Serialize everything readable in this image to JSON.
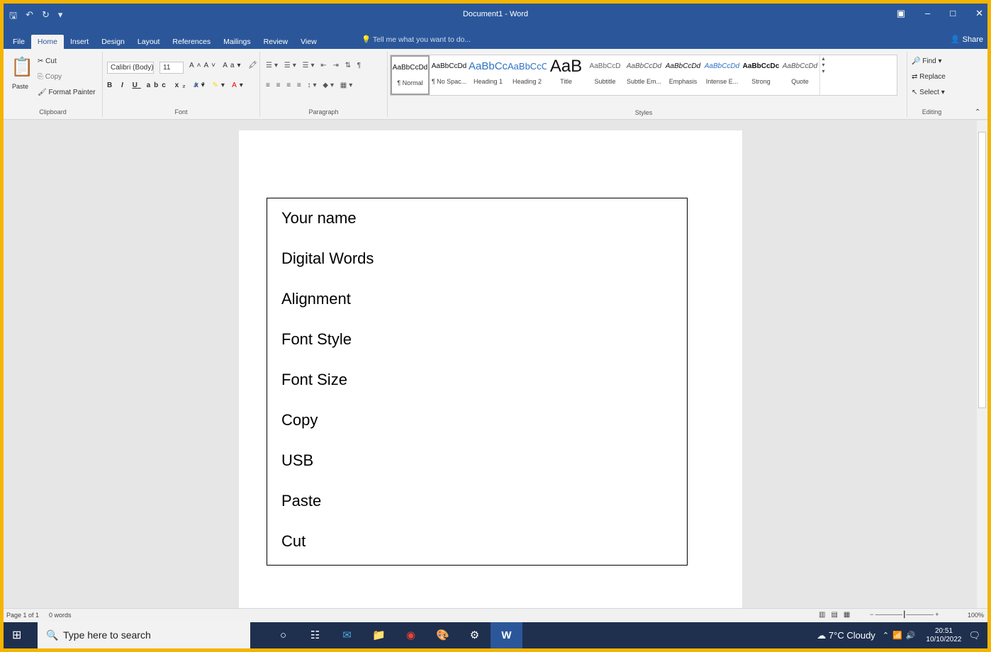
{
  "window": {
    "title": "Document1 - Word"
  },
  "menu": {
    "tabs": [
      {
        "label": "File"
      },
      {
        "label": "Home"
      },
      {
        "label": "Insert"
      },
      {
        "label": "Design"
      },
      {
        "label": "Layout"
      },
      {
        "label": "References"
      },
      {
        "label": "Mailings"
      },
      {
        "label": "Review"
      },
      {
        "label": "View"
      }
    ],
    "tell_me": "Tell me what you want to do...",
    "share": "Share"
  },
  "ribbon": {
    "clipboard": {
      "paste": "Paste",
      "cut": "Cut",
      "copy": "Copy",
      "format_painter": "Format Painter",
      "label": "Clipboard"
    },
    "font": {
      "family": "Calibri (Body)",
      "size": "11",
      "label": "Font"
    },
    "paragraph": {
      "label": "Paragraph"
    },
    "styles": {
      "items": [
        {
          "preview": "AaBbCcDd",
          "name": "¶ Normal"
        },
        {
          "preview": "AaBbCcDd",
          "name": "¶ No Spac..."
        },
        {
          "preview": "AaBbCc",
          "name": "Heading 1"
        },
        {
          "preview": "AaBbCcC",
          "name": "Heading 2"
        },
        {
          "preview": "AaB",
          "name": "Title"
        },
        {
          "preview": "AaBbCcD",
          "name": "Subtitle"
        },
        {
          "preview": "AaBbCcDd",
          "name": "Subtle Em..."
        },
        {
          "preview": "AaBbCcDd",
          "name": "Emphasis"
        },
        {
          "preview": "AaBbCcDd",
          "name": "Intense E..."
        },
        {
          "preview": "AaBbCcDc",
          "name": "Strong"
        },
        {
          "preview": "AaBbCcDd",
          "name": "Quote"
        }
      ],
      "label": "Styles"
    },
    "editing": {
      "find": "Find",
      "replace": "Replace",
      "select": "Select",
      "label": "Editing"
    }
  },
  "document": {
    "lines": [
      "Your name",
      "Digital Words",
      "Alignment",
      "Font Style",
      "Font Size",
      "Copy",
      "USB",
      "Paste",
      "Cut"
    ]
  },
  "status": {
    "page": "Page 1 of 1",
    "words": "0 words",
    "zoom": "100%"
  },
  "taskbar": {
    "search_placeholder": "Type here to search",
    "weather": "7°C Cloudy",
    "time": "20:51",
    "date": "10/10/2022"
  },
  "colors": {
    "word_blue": "#2b579a",
    "frame": "#f4b400",
    "taskbar": "#1f2f4e"
  }
}
